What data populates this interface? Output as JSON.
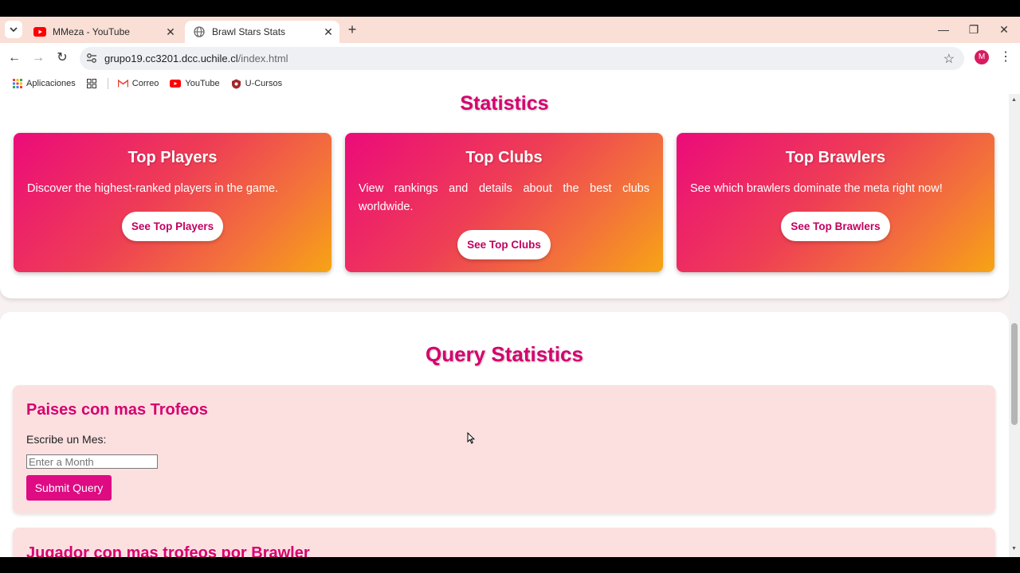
{
  "browser": {
    "tabs": [
      {
        "title": "MMeza - YouTube",
        "icon": "youtube-icon",
        "active": false
      },
      {
        "title": "Brawl Stars Stats",
        "icon": "globe-icon",
        "active": true
      }
    ],
    "url_host": "grupo19.cc3201.dcc.uchile.cl",
    "url_path": "/index.html",
    "profile_initial": "M",
    "bookmarks": [
      {
        "label": "Aplicaciones",
        "icon": "apps-grid-icon"
      },
      {
        "label": "Correo",
        "icon": "gmail-icon"
      },
      {
        "label": "YouTube",
        "icon": "youtube-icon"
      },
      {
        "label": "U-Cursos",
        "icon": "u-cursos-icon"
      }
    ]
  },
  "page": {
    "statistics_title": "Statistics",
    "cards": [
      {
        "title": "Top Players",
        "text": "Discover the highest-ranked players in the game.",
        "button": "See Top Players"
      },
      {
        "title": "Top Clubs",
        "text": "View rankings and details about the best clubs worldwide.",
        "button": "See Top Clubs"
      },
      {
        "title": "Top Brawlers",
        "text": "See which brawlers dominate the meta right now!",
        "button": "See Top Brawlers"
      }
    ],
    "query_title": "Query Statistics",
    "queries": [
      {
        "title": "Paises con mas Trofeos",
        "label": "Escribe un Mes:",
        "placeholder": "Enter a Month",
        "button": "Submit Query"
      },
      {
        "title": "Jugador con mas trofeos por Brawler"
      }
    ]
  },
  "colors": {
    "accent": "#d6006f",
    "button": "#de0b83",
    "card_gradient_start": "#ec0b7a",
    "card_gradient_end": "#f7a414",
    "query_bg": "#fce0e0"
  }
}
